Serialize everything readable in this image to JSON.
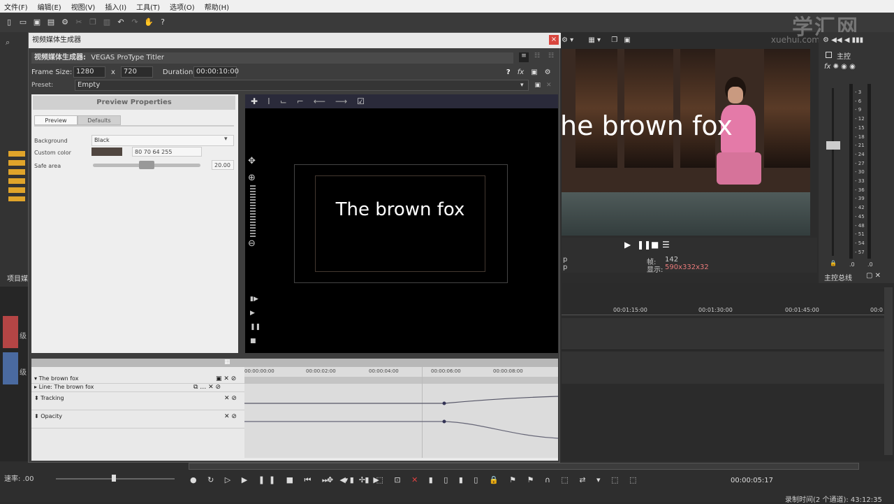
{
  "menu": [
    "文件(F)",
    "编辑(E)",
    "视图(V)",
    "插入(I)",
    "工具(T)",
    "选项(O)",
    "帮助(H)"
  ],
  "watermark": {
    "main": "学汇网",
    "sub": "xuehui.com"
  },
  "dialog": {
    "title": "视频媒体生成器",
    "subtitle_label": "视频媒体生成器:",
    "subtitle_value": "VEGAS ProType Titler",
    "frame_size_label": "Frame Size:",
    "frame_w": "1280",
    "x_label": "x",
    "frame_h": "720",
    "duration_label": "Duration:",
    "duration": "00:00:10:00",
    "preset_label": "Preset:",
    "preset": "Empty"
  },
  "props": {
    "header": "Preview Properties",
    "tab_preview": "Preview",
    "tab_defaults": "Defaults",
    "bg_label": "Background",
    "bg_value": "Black",
    "custom_label": "Custom color",
    "custom_value": "80 70 64 255",
    "custom_color": "#504640",
    "safe_label": "Safe area",
    "safe_value": "20.00"
  },
  "preview": {
    "text": "The brown fox"
  },
  "keyframes": {
    "ticks": [
      "00:00:00:00",
      "00:00:02:00",
      "00:00:04:00",
      "00:00:06:00",
      "00:00:08:00"
    ],
    "rows": [
      "The brown fox",
      "Line: The brown fox",
      "Tracking",
      "Opacity"
    ]
  },
  "right": {
    "video_text": "he brown fox",
    "frame_label": "帧:",
    "frame_value": "142",
    "display_label": "显示:",
    "display_value": "590x332x32",
    "p1": "p",
    "p2": "p"
  },
  "mixer": {
    "title": "主控",
    "scale": [
      "3",
      "6",
      "9",
      "12",
      "15",
      "18",
      "21",
      "24",
      "27",
      "30",
      "33",
      "36",
      "39",
      "42",
      "45",
      "48",
      "51",
      "54",
      "57"
    ],
    "bottom_l": ".0",
    "bottom_r": ".0",
    "bus": "主控总线"
  },
  "timeline": {
    "ticks": [
      "00:01:15:00",
      "00:01:30:00",
      "00:01:45:00",
      "00:0"
    ]
  },
  "left": {
    "project_label": "项目媒",
    "track1": "级",
    "track2": "级"
  },
  "bottom": {
    "rate_label": "速率: .00",
    "timecode": "00:00:05:17",
    "status": "录制时间(2 个通道): 43:12:35"
  }
}
